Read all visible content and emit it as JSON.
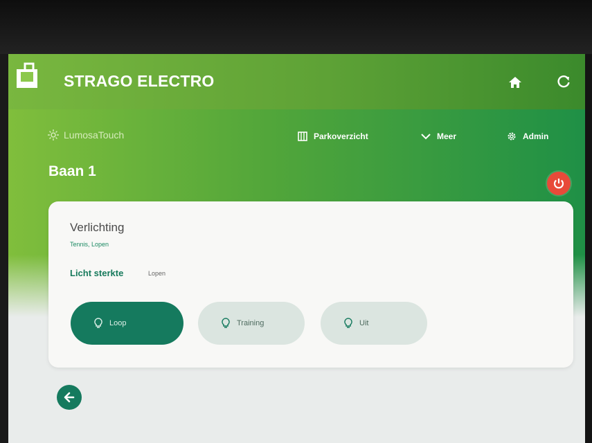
{
  "app": {
    "title": "STRAGO ELECTRO",
    "home_icon": "home-icon",
    "refresh_icon": "refresh-icon"
  },
  "header": {
    "brand": "LumosaTouch",
    "nav": [
      {
        "label": "Parkoverzicht",
        "icon": "map-icon"
      },
      {
        "label": "Meer",
        "icon": "chevron-down-icon"
      },
      {
        "label": "Admin",
        "icon": "gear-icon"
      }
    ],
    "page_title": "Baan 1"
  },
  "card": {
    "title": "Verlichting",
    "subtitle": "Tennis, Lopen",
    "light_label": "Licht sterkte",
    "light_value": "Lopen",
    "modes": [
      {
        "label": "Loop",
        "active": true
      },
      {
        "label": "Training",
        "active": false
      },
      {
        "label": "Uit",
        "active": false
      }
    ]
  },
  "colors": {
    "accent": "#157a5e",
    "power": "#e84a39",
    "header_green": "#5ea236"
  }
}
